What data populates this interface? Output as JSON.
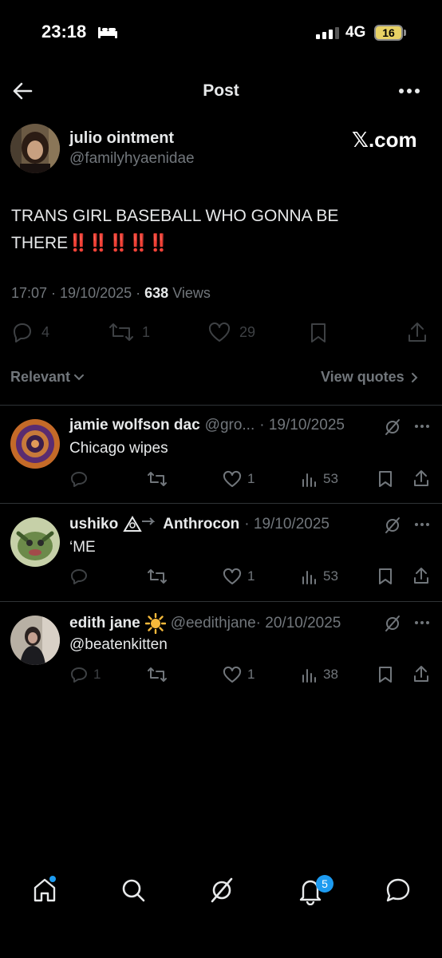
{
  "status_bar": {
    "time": "23:18",
    "network": "4G",
    "battery": "16"
  },
  "header": {
    "title": "Post"
  },
  "post": {
    "author_name": "julio ointment",
    "author_handle": "@familyhyaenidae",
    "source_badge": "𝕏.com",
    "text": "TRANS GIRL BASEBALL WHO GONNA BE THERE",
    "emphasis": "‼️‼️‼️‼️‼️",
    "time": "17:07",
    "date": "19/10/2025",
    "views_count": "638",
    "views_label": "Views",
    "replies": "4",
    "reposts": "1",
    "likes": "29"
  },
  "sort": {
    "relevant_label": "Relevant",
    "view_quotes_label": "View quotes"
  },
  "replies": [
    {
      "name": "jamie wolfson dac",
      "handle": "@gro...",
      "date": "· 19/10/2025",
      "text": "Chicago wipes",
      "replies": "",
      "likes": "1",
      "views": "53"
    },
    {
      "name": "ushiko",
      "name_suffix": "Anthrocon",
      "handle": "",
      "date": "· 19/10/2025",
      "text": "‘ME",
      "replies": "",
      "likes": "1",
      "views": "53"
    },
    {
      "name": "edith jane",
      "handle": "@eedithjane",
      "date": "· 20/10/2025",
      "text": "@beatenkitten",
      "replies": "1",
      "likes": "1",
      "views": "38"
    }
  ],
  "bottom_nav": {
    "notifications_badge": "5"
  },
  "colors": {
    "accent": "#1d9bf0",
    "background": "#000000",
    "muted": "#71767b",
    "emphasis": "#e0301e"
  }
}
